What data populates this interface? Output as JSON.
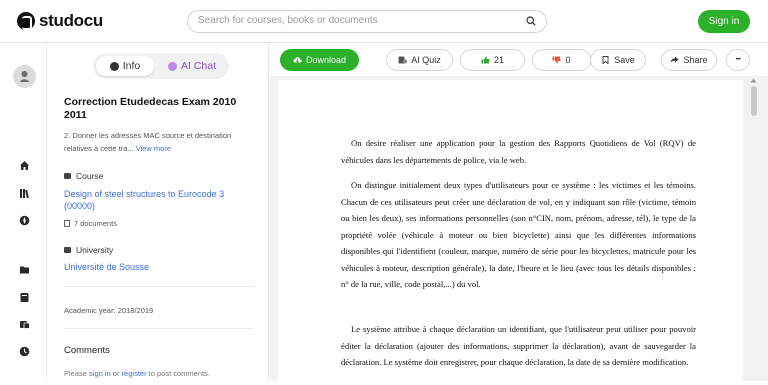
{
  "header": {
    "brand": "studocu",
    "search_placeholder": "Search for courses, books or documents",
    "signin_label": "Sign in"
  },
  "rail": {
    "icons": [
      "user-icon",
      "home-icon",
      "library-icon",
      "explore-icon",
      "folder-icon",
      "book-icon",
      "courses-icon",
      "time-icon"
    ]
  },
  "sidebar": {
    "tab_info": "Info",
    "tab_ai": "AI Chat",
    "doc_title": "Correction Etudedecas Exam 2010 2011",
    "doc_desc": "2. Donner les adresses MAC source et destination relatives à cette tra...",
    "view_more": "View more",
    "course_label": "Course",
    "course_name": "Design of steel structures to Eurocode 3 (00000)",
    "course_docs": "7 documents",
    "university_label": "University",
    "university_name": "Université de Sousse",
    "academic_year": "Academic year: 2018/2019",
    "comments_title": "Comments",
    "comments_note_pre": "Please ",
    "comments_signin": "sign in",
    "comments_or": " or ",
    "comments_register": "register",
    "comments_note_post": " to post comments."
  },
  "toolbar": {
    "download": "Download",
    "ai_quiz": "AI Quiz",
    "likes": "21",
    "dislikes": "0",
    "save": "Save",
    "share": "Share",
    "more": "•••"
  },
  "document": {
    "paragraphs": [
      "On desire réaliser une application pour la gestion des Rapports Quotidiens de Vol (RQV) de véhicules dans les départements de police, via le web.",
      "On distingue initialement deux types d'utilisateurs pour ce système : les victimes et les témoins. Chacun de ces utilisateurs peut créer une déclaration de vol, en y indiquant son rôle (victime, témoin ou bien les deux), ses informations personnelles (son n°CIN, nom, prénom, adresse, tél), le type de la propriété volée (véhicule à moteur ou bien bicyclette) ainsi que les différentes informations disponibles qui l'identifient (couleur, marque, numéro de série pour les bicyclettes, matricule pour les véhicules à moteur, description générale), la date, l'heure et le lieu (avec tous les détails disponibles : n° de la rue, ville, code postal,...) du vol.",
      "Le système attribue à chaque déclaration un identifiant, que l'utilisateur peut utiliser pour pouvoir éditer la déclaration (ajouter des informations, supprimer la déclaration), avant de sauvegarder la déclaration. Le système doit enregistrer, pour chaque déclaration, la date de sa dernière modification."
    ]
  },
  "colors": {
    "brand_green": "#2ab02a",
    "link_blue": "#3a6fd8",
    "ai_purple": "#8a4fd1"
  }
}
